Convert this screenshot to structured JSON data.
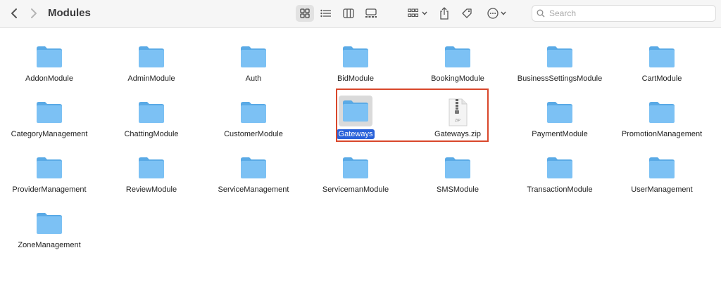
{
  "window": {
    "title": "Modules"
  },
  "search": {
    "placeholder": "Search"
  },
  "items": [
    {
      "label": "AddonModule",
      "type": "folder"
    },
    {
      "label": "AdminModule",
      "type": "folder"
    },
    {
      "label": "Auth",
      "type": "folder"
    },
    {
      "label": "BidModule",
      "type": "folder"
    },
    {
      "label": "BookingModule",
      "type": "folder"
    },
    {
      "label": "BusinessSettingsModule",
      "type": "folder"
    },
    {
      "label": "CartModule",
      "type": "folder"
    },
    {
      "label": "CategoryManagement",
      "type": "folder"
    },
    {
      "label": "ChattingModule",
      "type": "folder"
    },
    {
      "label": "CustomerModule",
      "type": "folder"
    },
    {
      "label": "Gateways",
      "type": "folder",
      "selected": true
    },
    {
      "label": "Gateways.zip",
      "type": "zip"
    },
    {
      "label": "PaymentModule",
      "type": "folder"
    },
    {
      "label": "PromotionManagement",
      "type": "folder"
    },
    {
      "label": "ProviderManagement",
      "type": "folder"
    },
    {
      "label": "ReviewModule",
      "type": "folder"
    },
    {
      "label": "ServiceManagement",
      "type": "folder"
    },
    {
      "label": "ServicemanModule",
      "type": "folder"
    },
    {
      "label": "SMSModule",
      "type": "folder"
    },
    {
      "label": "TransactionModule",
      "type": "folder"
    },
    {
      "label": "UserManagement",
      "type": "folder"
    },
    {
      "label": "ZoneManagement",
      "type": "folder"
    }
  ],
  "colors": {
    "folder": "#7cc1f4",
    "folder_tab": "#5aaae6",
    "selection": "#2a62d9",
    "highlight": "#d9472b"
  },
  "zip_badge": "ZIP"
}
